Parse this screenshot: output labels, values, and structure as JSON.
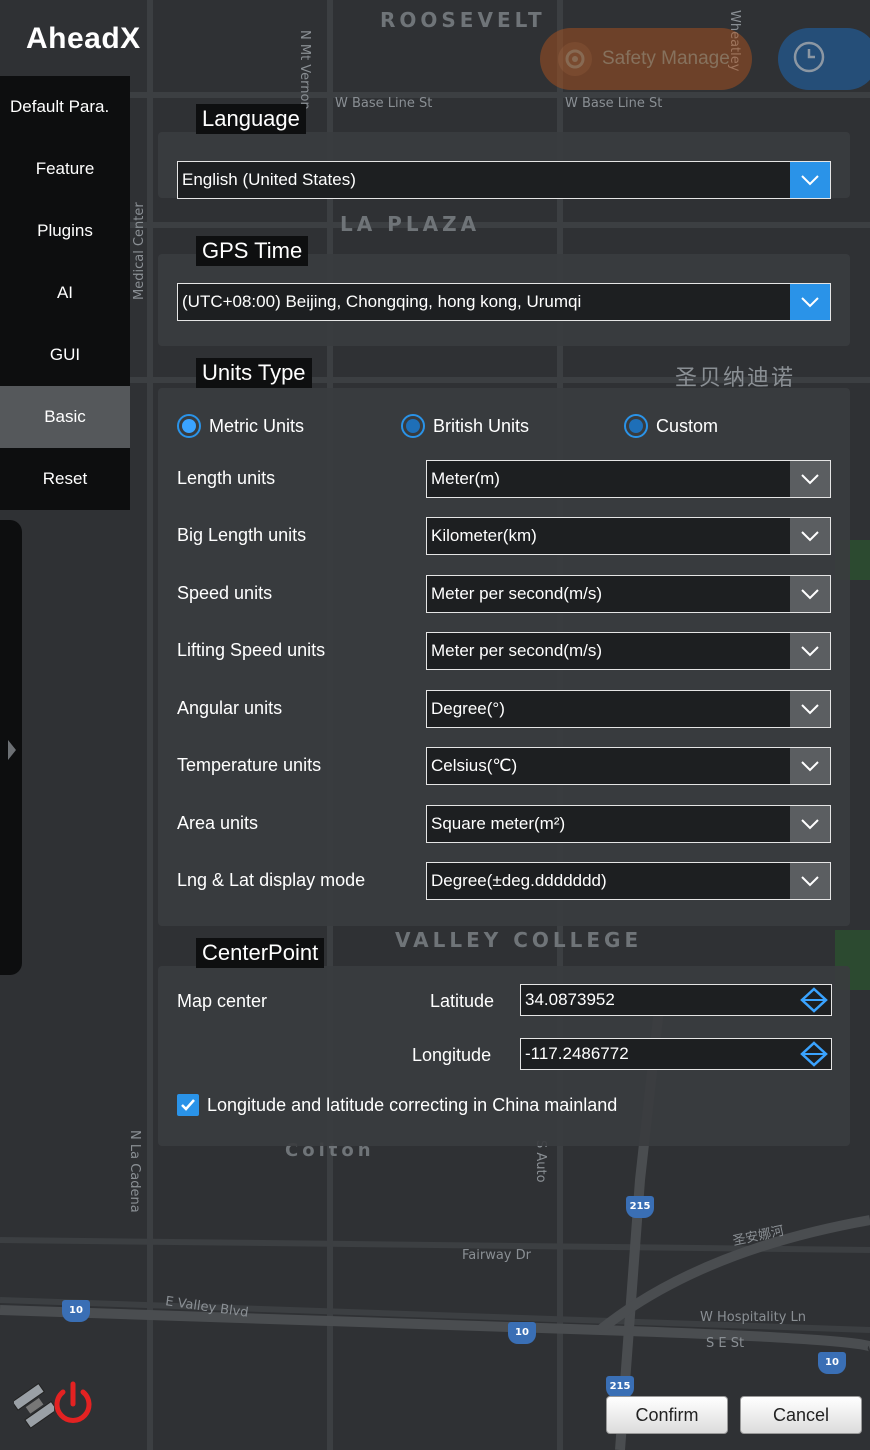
{
  "app": {
    "logo": "AheadX"
  },
  "map": {
    "labels": {
      "roosevelt": "ROOSEVELT",
      "base_line_1": "W Base Line St",
      "base_line_2": "W Base Line St",
      "la_plaza": "LA PLAZA",
      "chinese_place": "圣贝纳迪诺",
      "valley_college": "VALLEY COLLEGE",
      "colton": "Colton",
      "fairway": "Fairway Dr",
      "valley_blvd": "E Valley Blvd",
      "hospitality": "W Hospitality Ln",
      "e_st": "S E St",
      "river": "圣安娜河",
      "medical_center": "Medical Center",
      "n_mt_vernon": "N Mt Vernon",
      "s_auto": "S Auto",
      "n_la_cadena": "N La Cadena",
      "wheatley": "Wheatley"
    },
    "shields": [
      "215",
      "10",
      "10",
      "215",
      "10"
    ]
  },
  "top_buttons": {
    "safety_label": "Safety Manage"
  },
  "sidebar": {
    "items": [
      {
        "label": "Default Para."
      },
      {
        "label": "Feature"
      },
      {
        "label": "Plugins"
      },
      {
        "label": "AI"
      },
      {
        "label": "GUI"
      },
      {
        "label": "Basic",
        "active": true
      },
      {
        "label": "Reset"
      }
    ]
  },
  "language": {
    "title": "Language",
    "value": "English (United States)"
  },
  "gps_time": {
    "title": "GPS Time",
    "value": "(UTC+08:00) Beijing, Chongqing, hong kong, Urumqi"
  },
  "units": {
    "title": "Units Type",
    "radios": [
      {
        "label": "Metric Units",
        "checked": true
      },
      {
        "label": "British Units",
        "checked": false
      },
      {
        "label": "Custom",
        "checked": false
      }
    ],
    "rows": [
      {
        "label": "Length units",
        "value": "Meter(m)"
      },
      {
        "label": "Big Length units",
        "value": "Kilometer(km)"
      },
      {
        "label": "Speed units",
        "value": "Meter per second(m/s)"
      },
      {
        "label": "Lifting Speed units",
        "value": "Meter per second(m/s)"
      },
      {
        "label": "Angular units",
        "value": "Degree(°)"
      },
      {
        "label": "Temperature units",
        "value": "Celsius(℃)"
      },
      {
        "label": "Area units",
        "value": "Square meter(m²)"
      },
      {
        "label": "Lng & Lat display mode",
        "value": "Degree(±deg.ddddddd)"
      }
    ]
  },
  "center_point": {
    "title": "CenterPoint",
    "map_center_label": "Map center",
    "latitude_label": "Latitude",
    "latitude_value": "34.0873952",
    "longitude_label": "Longitude",
    "longitude_value": "-117.2486772",
    "correcting_label": "Longitude and latitude correcting in China mainland",
    "correcting_checked": true
  },
  "footer": {
    "confirm_label": "Confirm",
    "cancel_label": "Cancel"
  },
  "colors": {
    "accent": "#2a93e8",
    "sidebar_bg": "#0d0e0f",
    "active_item": "#55585b",
    "power": "#e32222"
  }
}
